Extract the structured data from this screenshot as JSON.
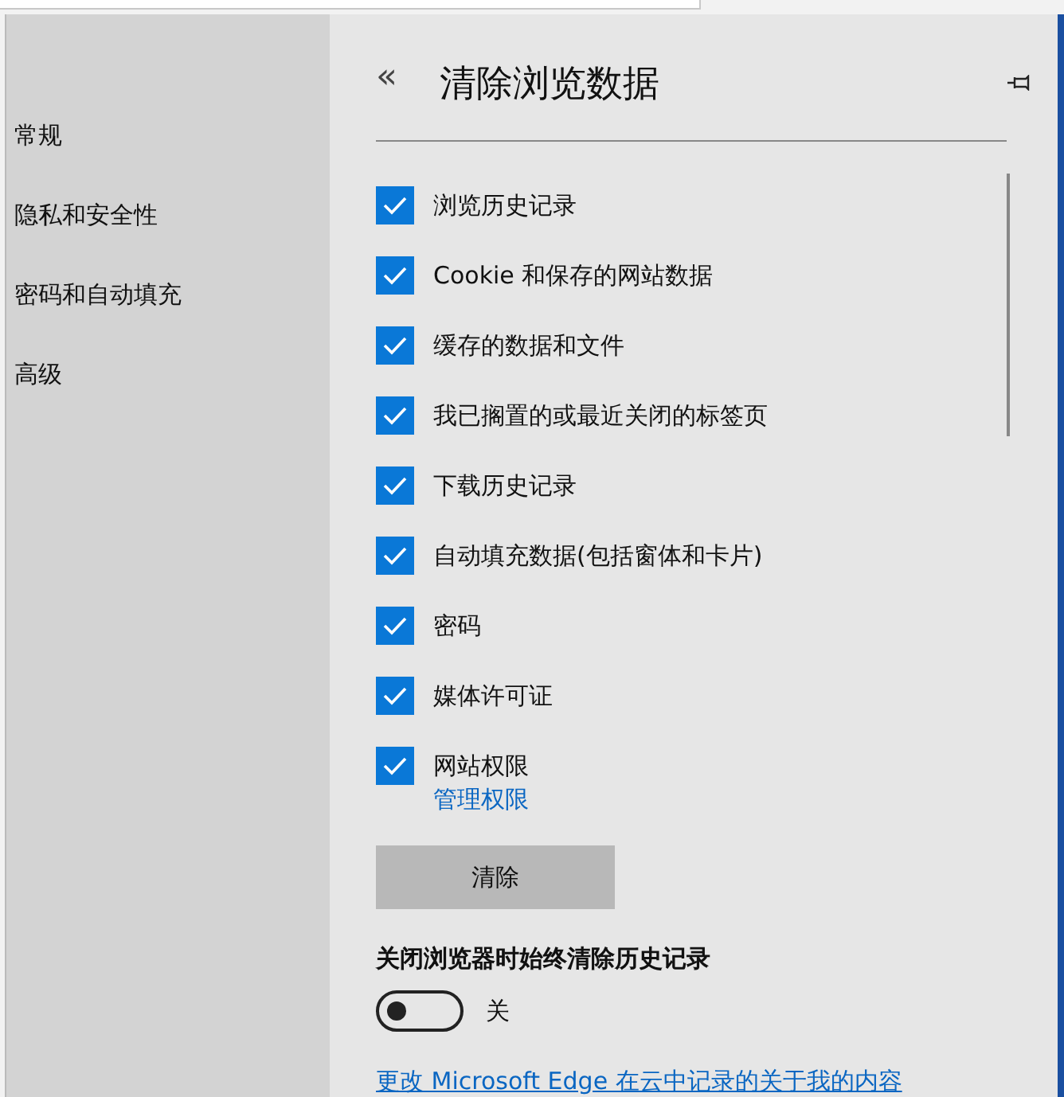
{
  "sidebar": {
    "items": [
      {
        "label": "常规"
      },
      {
        "label": "隐私和安全性"
      },
      {
        "label": "密码和自动填充"
      },
      {
        "label": "高级"
      }
    ]
  },
  "panel": {
    "back": "«",
    "title": "清除浏览数据",
    "options": [
      {
        "label": "浏览历史记录",
        "checked": true
      },
      {
        "label": "Cookie 和保存的网站数据",
        "checked": true
      },
      {
        "label": "缓存的数据和文件",
        "checked": true
      },
      {
        "label": "我已搁置的或最近关闭的标签页",
        "checked": true
      },
      {
        "label": "下载历史记录",
        "checked": true
      },
      {
        "label": "自动填充数据(包括窗体和卡片)",
        "checked": true
      },
      {
        "label": "密码",
        "checked": true
      },
      {
        "label": "媒体许可证",
        "checked": true
      },
      {
        "label": "网站权限",
        "checked": true
      }
    ],
    "manage_link": "管理权限",
    "clear_button": "清除",
    "always_clear": {
      "heading": "关闭浏览器时始终清除历史记录",
      "on": false,
      "state_label": "关"
    },
    "bottom_link": "更改 Microsoft Edge 在云中记录的关于我的内容"
  }
}
